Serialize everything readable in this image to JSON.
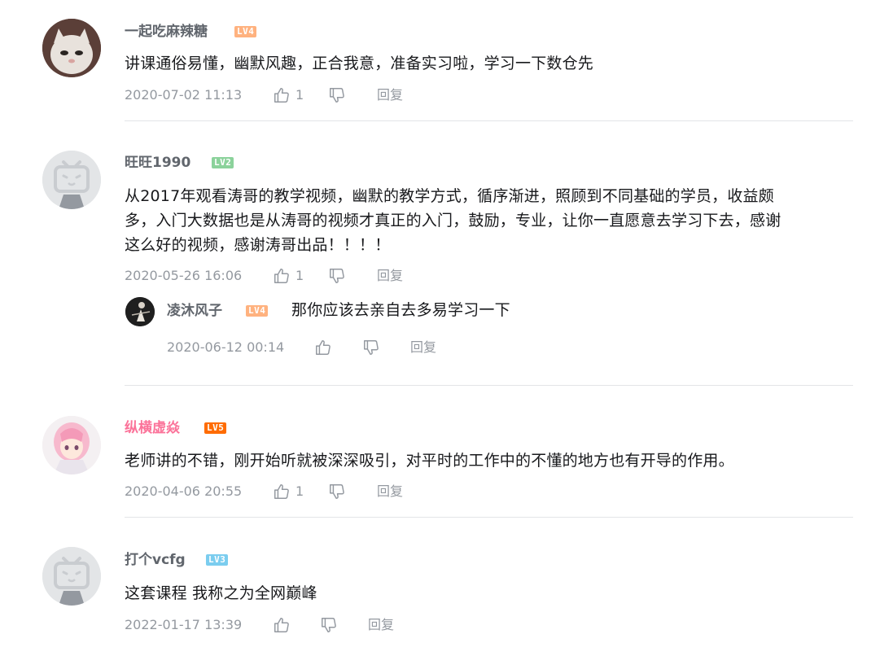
{
  "comments": [
    {
      "username": "一起吃麻辣糖",
      "level": "LV4",
      "level_color": "#ffb27f",
      "text": "讲课通俗易懂，幽默风趣，正合我意，准备实习啦，学习一下数仓先",
      "date": "2020-07-02 11:13",
      "likes": "1",
      "reply_label": "回复"
    },
    {
      "username": "旺旺1990",
      "level": "LV2",
      "level_color": "#8bd29b",
      "text_lines": [
        "从2017年观看涛哥的教学视频，幽默的教学方式，循序渐进，照顾到不同基础的学员，收益颇",
        "多，入门大数据也是从涛哥的视频才真正的入门，鼓励，专业，让你一直愿意去学习下去，感谢",
        "这么好的视频，感谢涛哥出品！！！！"
      ],
      "date": "2020-05-26 16:06",
      "likes": "1",
      "reply_label": "回复",
      "reply": {
        "username": "凌沐风子",
        "level": "LV4",
        "level_color": "#ffb27f",
        "text": "那你应该去亲自去多易学习一下",
        "date": "2020-06-12 00:14",
        "reply_label": "回复"
      }
    },
    {
      "username": "纵横虚焱",
      "level": "LV5",
      "level_color": "#ff6c00",
      "username_color": "#fb7299",
      "text": "老师讲的不错，刚开始听就被深深吸引，对平时的工作中的不懂的地方也有开导的作用。",
      "date": "2020-04-06 20:55",
      "likes": "1",
      "reply_label": "回复"
    },
    {
      "username": "打个vcfg",
      "level": "LV3",
      "level_color": "#7bcdef",
      "text": "这套课程 我称之为全网巅峰",
      "date": "2022-01-17 13:39",
      "reply_label": "回复"
    }
  ],
  "icons": {
    "like": "thumbs-up-icon",
    "dislike": "thumbs-down-icon",
    "default_avatar": "tv-face-avatar"
  }
}
